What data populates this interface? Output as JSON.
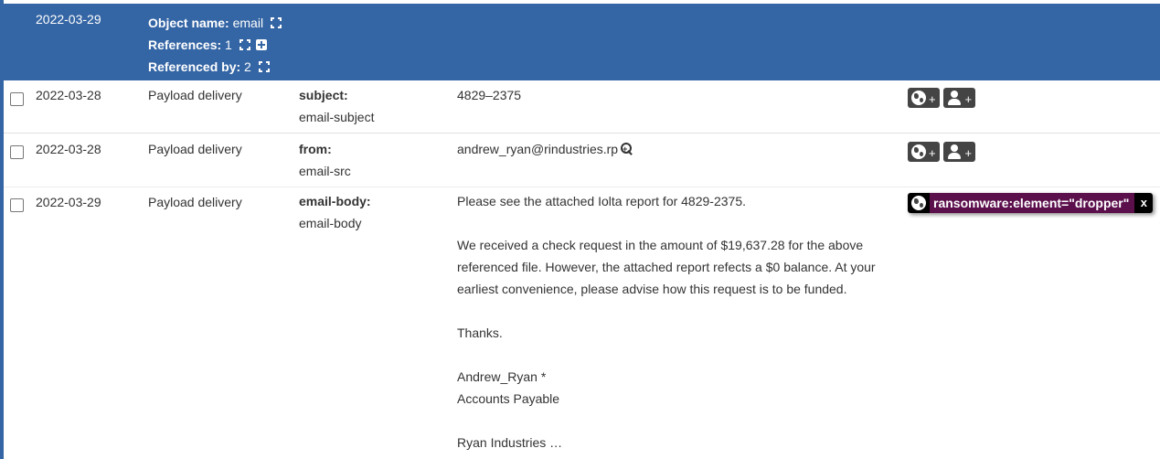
{
  "object": {
    "date": "2022-03-29",
    "name_label": "Object name:",
    "name_value": "email",
    "references_label": "References:",
    "references_value": "1",
    "referenced_by_label": "Referenced by:",
    "referenced_by_value": "2"
  },
  "colors": {
    "object_header": "#3465a4",
    "tag_bg": "#5b0f4b",
    "tag_button_bg": "#444444"
  },
  "attributes": [
    {
      "date": "2022-03-28",
      "category": "Payload delivery",
      "relation": "subject:",
      "type": "email-subject",
      "value": "4829–2375",
      "tag_buttons": [
        {
          "icon": "globe-icon",
          "label": "+"
        },
        {
          "icon": "user-icon",
          "label": "+"
        }
      ]
    },
    {
      "date": "2022-03-28",
      "category": "Payload delivery",
      "relation": "from:",
      "type": "email-src",
      "value": "andrew_ryan@rindustries.rp",
      "value_icon": "search-plus-icon",
      "tag_buttons": [
        {
          "icon": "globe-icon",
          "label": "+"
        },
        {
          "icon": "user-icon",
          "label": "+"
        }
      ]
    },
    {
      "date": "2022-03-29",
      "category": "Payload delivery",
      "relation": "email-body:",
      "type": "email-body",
      "value_lines": [
        "Please see the attached Iolta report for 4829-2375.",
        "",
        "We received a check request in the amount of $19,637.28 for the above",
        "referenced file. However, the attached report refects a $0 balance. At your",
        "earliest convenience, please advise how this request is to be funded.",
        "",
        "Thanks.",
        "",
        "Andrew_Ryan *",
        "Accounts Payable",
        "",
        "Ryan Industries …"
      ],
      "tag": {
        "icon": "globe-icon",
        "label": "ransomware:element=\"dropper\"",
        "remove": "x"
      }
    }
  ]
}
